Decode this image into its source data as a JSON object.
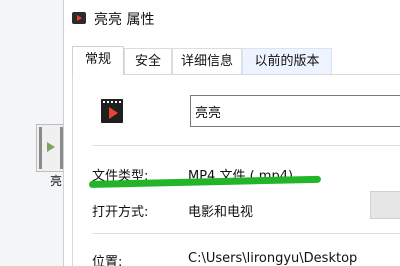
{
  "desktop": {
    "file_label": "亮"
  },
  "window": {
    "title": "亮亮 属性"
  },
  "tabs": [
    {
      "label": "常规"
    },
    {
      "label": "安全"
    },
    {
      "label": "详细信息"
    },
    {
      "label": "以前的版本"
    }
  ],
  "general": {
    "file_name": "亮亮",
    "file_type_label": "文件类型:",
    "file_type_value": "MP4 文件 (.mp4)",
    "opens_with_label": "打开方式:",
    "opens_with_value": "电影和电视",
    "location_label": "位置:",
    "location_value": "C:\\Users\\lirongyu\\Desktop"
  },
  "colors": {
    "highlight": "#22b528"
  }
}
